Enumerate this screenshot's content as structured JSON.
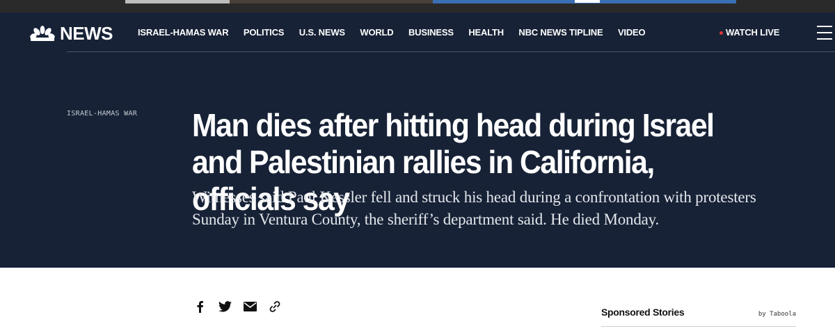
{
  "brand": {
    "name": "NEWS"
  },
  "nav": {
    "links": [
      "ISRAEL-HAMAS WAR",
      "POLITICS",
      "U.S. NEWS",
      "WORLD",
      "BUSINESS",
      "HEALTH",
      "NBC NEWS TIPLINE",
      "VIDEO"
    ],
    "watch_live": "WATCH LIVE"
  },
  "article": {
    "eyebrow": "ISRAEL-HAMAS WAR",
    "headline": "Man dies after hitting head during Israel and Palestinian rallies in California, officials say",
    "dek": "Witnesses said Paul Kessler fell and struck his head during a confrontation with protesters Sunday in Ventura County, the sheriff’s department said. He died Monday."
  },
  "share": {
    "icons": [
      "facebook-icon",
      "twitter-icon",
      "email-icon",
      "link-icon"
    ]
  },
  "sponsored": {
    "title": "Sponsored Stories",
    "by": "by Taboola"
  },
  "colors": {
    "header_bg": "#172236",
    "live_dot": "#e0333b",
    "text_on_dark": "#ffffff"
  }
}
